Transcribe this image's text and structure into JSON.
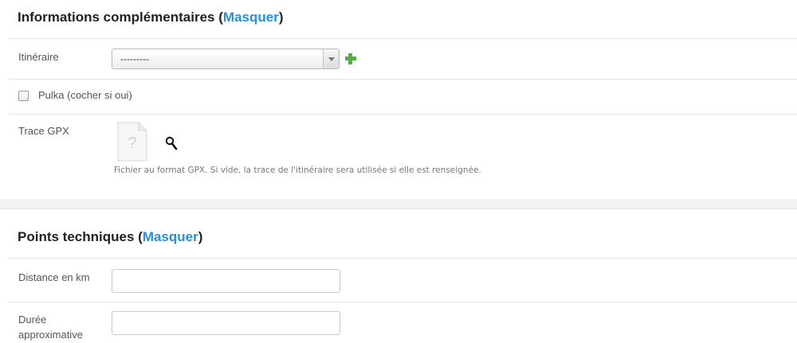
{
  "section1": {
    "title": "Informations complémentaires",
    "paren_open": " (",
    "toggle": "Masquer",
    "paren_close": ")",
    "itinerary_label": "Itinéraire",
    "itinerary_value": "---------",
    "pulka_label": "Pulka (cocher si oui)",
    "pulka_checked": false,
    "gpx_label": "Trace GPX",
    "gpx_help": "Fichier au format GPX. Si vide, la trace de l'itinéraire sera utilisée si elle est renseignée."
  },
  "section2": {
    "title": "Points techniques",
    "paren_open": " (",
    "toggle": "Masquer",
    "paren_close": ")",
    "distance_label": "Distance en km",
    "distance_value": "",
    "duree_label_1": "Durée",
    "duree_label_2": "approximative",
    "duree_value": ""
  },
  "icons": {
    "add": "plus-icon",
    "file": "file-placeholder-icon",
    "search": "search-icon",
    "dropdown": "chevron-down-icon"
  },
  "colors": {
    "link": "#2a8fd8",
    "add": "#4fb33c"
  }
}
